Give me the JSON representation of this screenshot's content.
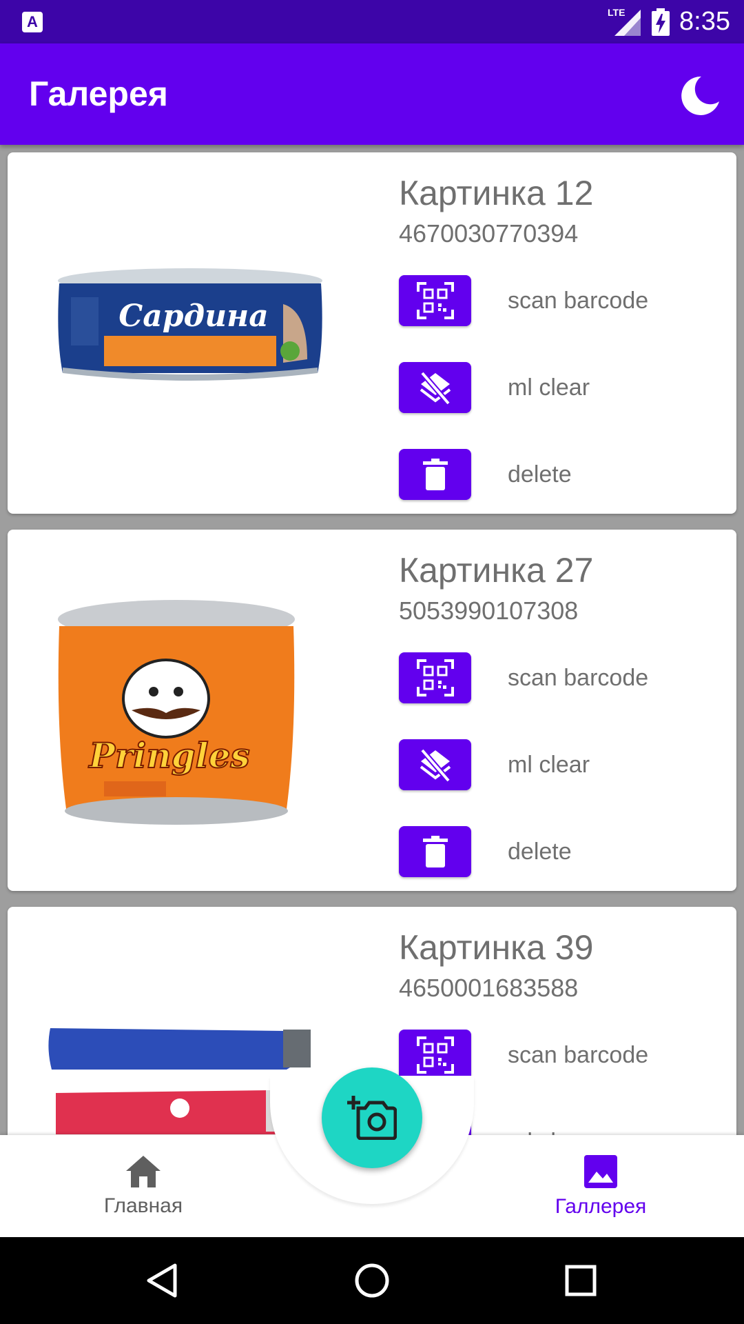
{
  "status_bar": {
    "app_icon_letter": "A",
    "network": "LTE",
    "time": "8:35"
  },
  "app_bar": {
    "title": "Галерея",
    "theme_icon": "moon-icon"
  },
  "items": [
    {
      "title": "Картинка 12",
      "barcode": "4670030770394",
      "image_label": "Сардина",
      "actions": [
        {
          "label": "scan barcode",
          "icon": "qr-scan-icon"
        },
        {
          "label": "ml clear",
          "icon": "layers-clear-icon"
        },
        {
          "label": "delete",
          "icon": "trash-icon"
        }
      ]
    },
    {
      "title": "Картинка 27",
      "barcode": "5053990107308",
      "image_label": "Pringles",
      "actions": [
        {
          "label": "scan barcode",
          "icon": "qr-scan-icon"
        },
        {
          "label": "ml clear",
          "icon": "layers-clear-icon"
        },
        {
          "label": "delete",
          "icon": "trash-icon"
        }
      ]
    },
    {
      "title": "Картинка 39",
      "barcode": "4650001683588",
      "actions": [
        {
          "label": "scan barcode",
          "icon": "qr-scan-icon"
        },
        {
          "label": "ml clear",
          "icon": "layers-clear-icon"
        }
      ]
    }
  ],
  "bottom_nav": {
    "home_label": "Главная",
    "gallery_label": "Галлерея",
    "active_color": "#6200ee",
    "inactive_color": "#5f5f5f"
  },
  "fab": {
    "icon": "add-photo-icon",
    "color": "#1ed6c4"
  },
  "colors": {
    "primary": "#6200ee",
    "status_bar": "#3d05a8"
  }
}
